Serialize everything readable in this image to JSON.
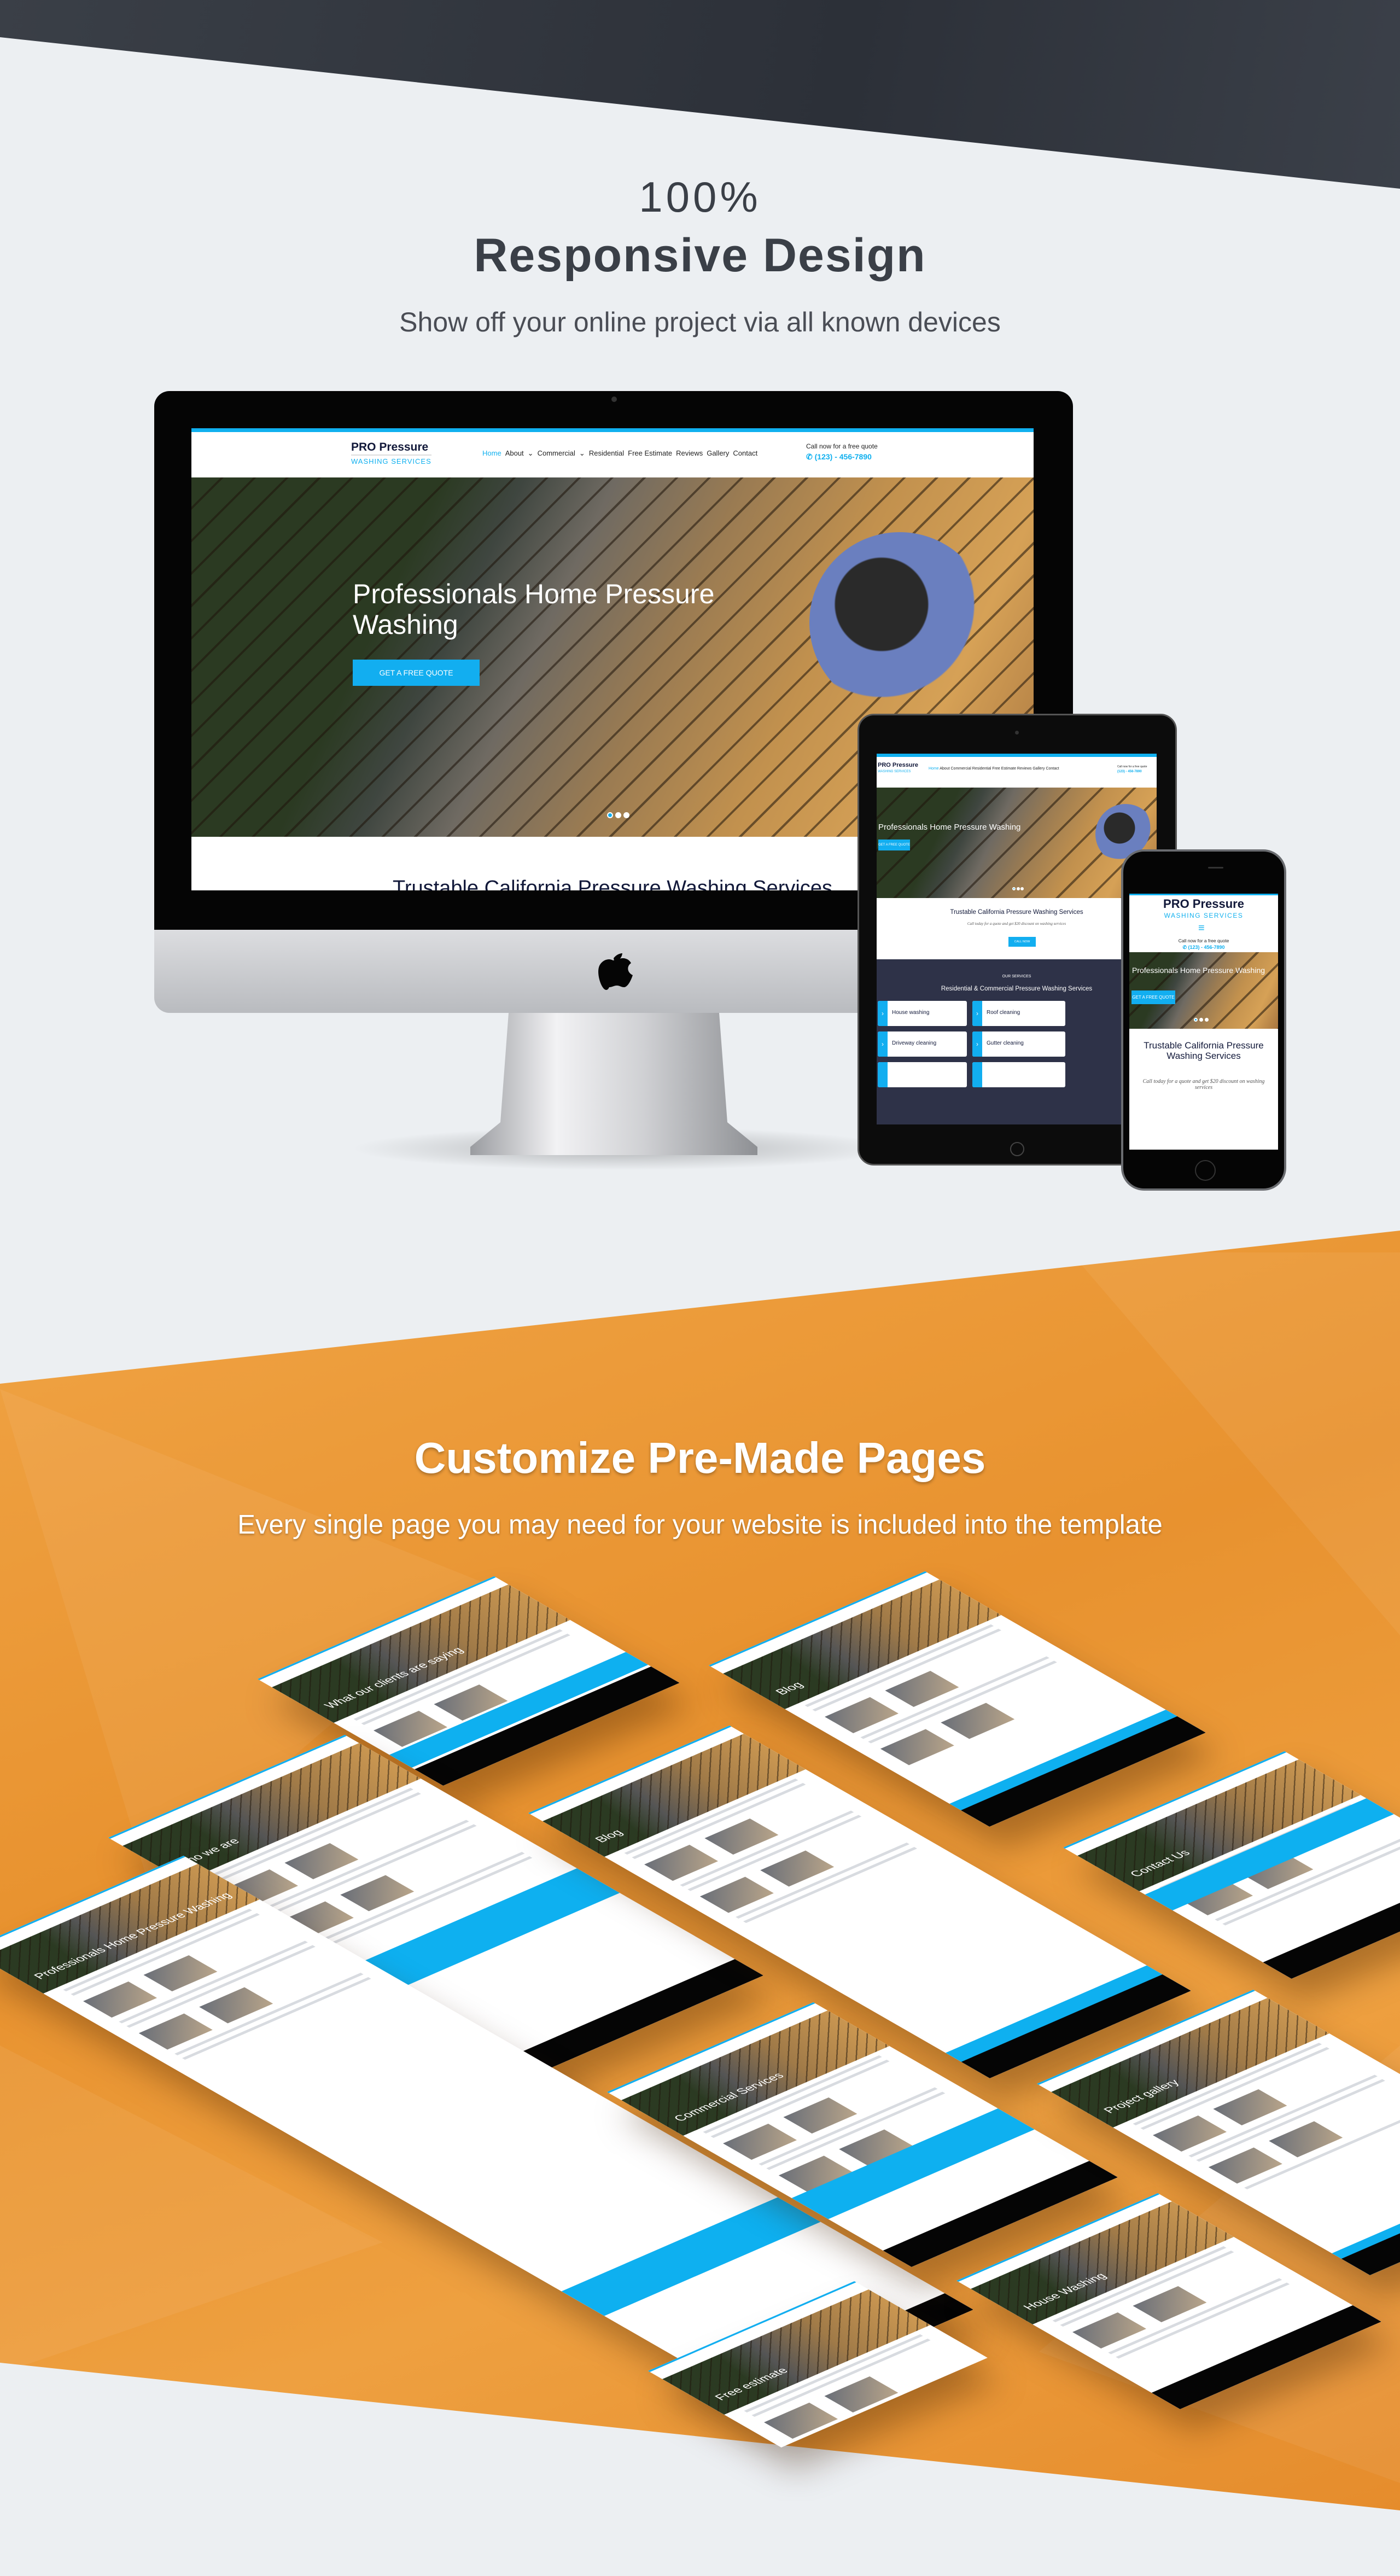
{
  "responsive": {
    "pre": "100%",
    "title": "Responsive Design",
    "subtitle": "Show off your online project via all known devices"
  },
  "site": {
    "logo_top": "PRO Pressure",
    "logo_bottom": "WASHING SERVICES",
    "nav": [
      "Home",
      "About",
      "Commercial",
      "Residential",
      "Free Estimate",
      "Reviews",
      "Gallery",
      "Contact"
    ],
    "call_label": "Call now for a free quote",
    "phone": "(123) - 456-7890",
    "hero_title": "Professionals Home Pressure Washing",
    "hero_button": "GET A FREE QUOTE",
    "section_title": "Trustable California Pressure Washing Services",
    "section_text": "Call today for a quote and get $20 discount on washing services",
    "call_button": "CALL NOW",
    "services_kicker": "OUR SERVICES",
    "services_title": "Residential & Commercial Pressure Washing Services",
    "services": [
      "House washing",
      "Roof cleaning",
      "Driveway cleaning",
      "Gutter cleaning"
    ],
    "accent": "#10b0ef",
    "navy": "#12193a"
  },
  "premade": {
    "title": "Customize Pre-Made Pages",
    "subtitle": "Every single page you may need for your website is included into the template",
    "pages": [
      "What our clients are saying",
      "Blog",
      "Who we are",
      "Blog",
      "Contact Us",
      "Professionals Home Pressure Washing",
      "Commercial Services",
      "Project gallery",
      "House Washing",
      "Free estimate"
    ]
  },
  "colors": {
    "orange": "#ec9a3a",
    "dark": "#2f333b",
    "background": "#eceff2"
  }
}
